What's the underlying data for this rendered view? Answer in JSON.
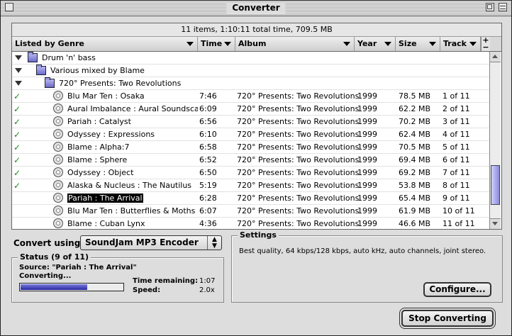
{
  "window": {
    "title": "Converter"
  },
  "list": {
    "summary": "11 items, 1:10:11 total time, 709.5 MB",
    "columns": [
      "Listed by Genre",
      "Time",
      "Album",
      "Year",
      "Size",
      "Track"
    ],
    "header_buttons": [
      "+",
      "−"
    ],
    "groups": [
      {
        "label": "Drum 'n' bass"
      },
      {
        "label": "Various mixed by Blame"
      },
      {
        "label": "720° Presents: Two Revolutions"
      }
    ],
    "tracks": [
      {
        "checked": true,
        "song": "Blu Mar Ten : Osaka",
        "time": "7:46",
        "album": "720° Presents: Two Revolutions",
        "year": "1999",
        "size": "78.5 MB",
        "track": "1 of 11"
      },
      {
        "checked": true,
        "song": "Aural Imbalance : Aural Soundscapes",
        "time": "6:09",
        "album": "720° Presents: Two Revolutions",
        "year": "1999",
        "size": "62.2 MB",
        "track": "2 of 11"
      },
      {
        "checked": true,
        "song": "Pariah : Catalyst",
        "time": "6:56",
        "album": "720° Presents: Two Revolutions",
        "year": "1999",
        "size": "70.2 MB",
        "track": "3 of 11"
      },
      {
        "checked": true,
        "song": "Odyssey : Expressions",
        "time": "6:10",
        "album": "720° Presents: Two Revolutions",
        "year": "1999",
        "size": "62.4 MB",
        "track": "4 of 11"
      },
      {
        "checked": true,
        "song": "Blame : Alpha:7",
        "time": "6:58",
        "album": "720° Presents: Two Revolutions",
        "year": "1999",
        "size": "70.5 MB",
        "track": "5 of 11"
      },
      {
        "checked": true,
        "song": "Blame : Sphere",
        "time": "6:52",
        "album": "720° Presents: Two Revolutions",
        "year": "1999",
        "size": "69.4 MB",
        "track": "6 of 11"
      },
      {
        "checked": true,
        "song": "Odyssey : Object",
        "time": "6:50",
        "album": "720° Presents: Two Revolutions",
        "year": "1999",
        "size": "69.2 MB",
        "track": "7 of 11"
      },
      {
        "checked": true,
        "song": "Alaska & Nucleus : The Nautilus",
        "time": "5:19",
        "album": "720° Presents: Two Revolutions",
        "year": "1999",
        "size": "53.8 MB",
        "track": "8 of 11"
      },
      {
        "checked": false,
        "song": "Pariah : The Arrival",
        "time": "6:28",
        "album": "720° Presents: Two Revolutions",
        "year": "1999",
        "size": "65.4 MB",
        "track": "9 of 11",
        "selected": true
      },
      {
        "checked": false,
        "song": "Blu Mar Ten : Butterflies & Moths",
        "time": "6:07",
        "album": "720° Presents: Two Revolutions",
        "year": "1999",
        "size": "61.9 MB",
        "track": "10 of 11"
      },
      {
        "checked": false,
        "song": "Blame : Cuban Lynx",
        "time": "4:36",
        "album": "720° Presents: Two Revolutions",
        "year": "1999",
        "size": "46.6 MB",
        "track": "11 of 11"
      }
    ]
  },
  "convert": {
    "label": "Convert using:",
    "encoder": "SoundJam MP3 Encoder"
  },
  "status": {
    "title": "Status (9 of 11)",
    "source": "Source: \"Pariah : The Arrival\"",
    "state": "Converting...",
    "progress": 0.65,
    "time_remaining_label": "Time remaining:",
    "time_remaining": "1:07",
    "speed_label": "Speed:",
    "speed": "2.0x"
  },
  "settings": {
    "title": "Settings",
    "text": "Best quality, 64 kbps/128 kbps, auto kHz, auto channels, joint stereo.",
    "configure_label": "Configure..."
  },
  "stop_label": "Stop Converting",
  "colors": {
    "check": "#1a8a1a",
    "progress": "#2828a0",
    "selection": "#000000"
  }
}
